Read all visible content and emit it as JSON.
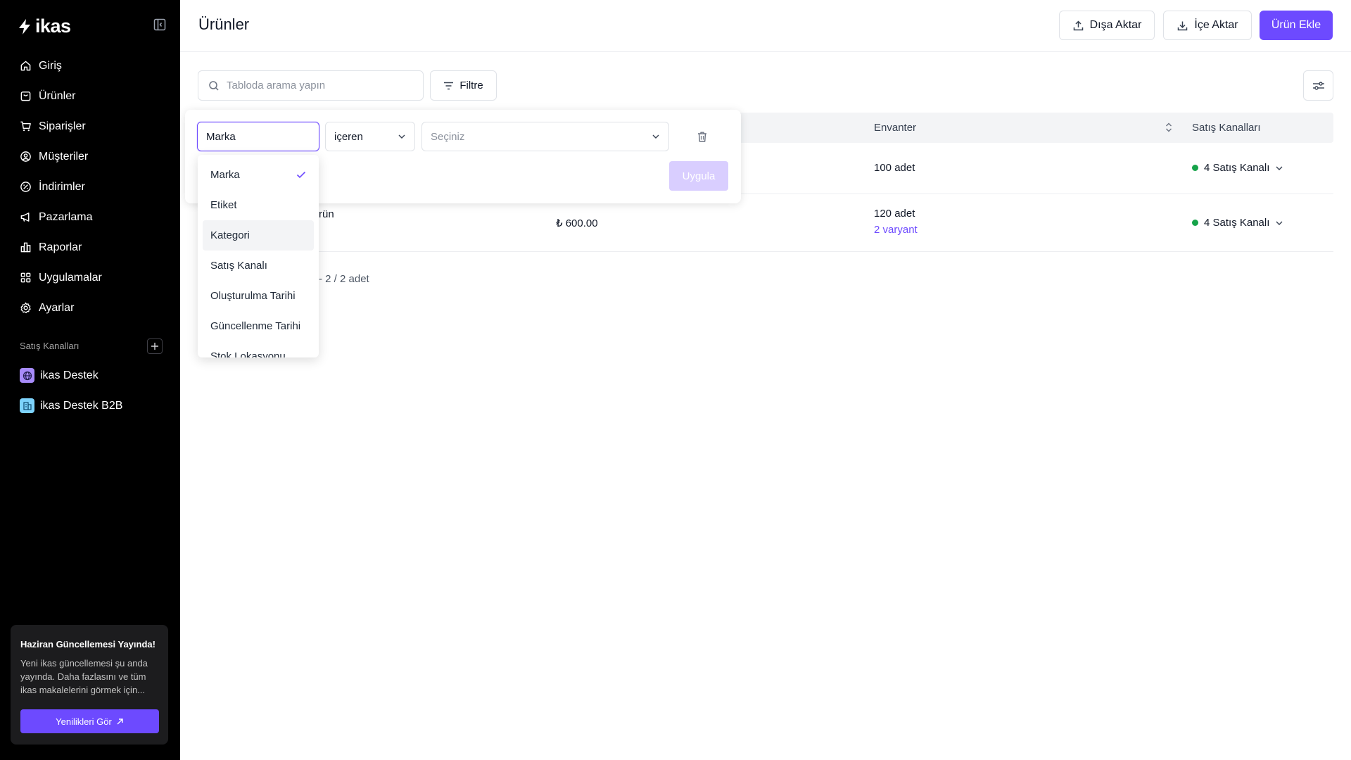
{
  "brand": {
    "name": "ikas",
    "accent": "#6d4aff"
  },
  "sidebar": {
    "items": [
      {
        "label": "Giriş",
        "icon": "home-icon"
      },
      {
        "label": "Ürünler",
        "icon": "box-icon"
      },
      {
        "label": "Siparişler",
        "icon": "cart-icon"
      },
      {
        "label": "Müşteriler",
        "icon": "user-circle-icon"
      },
      {
        "label": "İndirimler",
        "icon": "discount-icon"
      },
      {
        "label": "Pazarlama",
        "icon": "megaphone-icon"
      },
      {
        "label": "Raporlar",
        "icon": "chart-icon"
      },
      {
        "label": "Uygulamalar",
        "icon": "apps-grid-icon"
      },
      {
        "label": "Ayarlar",
        "icon": "gear-icon"
      }
    ],
    "channels_title": "Satış Kanalları",
    "channels": [
      {
        "label": "ikas Destek",
        "icon": "globe-icon",
        "color": "#a78bfa"
      },
      {
        "label": "ikas Destek B2B",
        "icon": "building-icon",
        "color": "#7dd3fc"
      }
    ],
    "promo": {
      "title": "Haziran Güncellemesi Yayında!",
      "text": "Yeni ikas güncellemesi şu anda yayında. Daha fazlasını ve tüm ikas makalelerini görmek için...",
      "button": "Yenilikleri Gör"
    }
  },
  "header": {
    "title": "Ürünler",
    "export_label": "Dışa Aktar",
    "import_label": "İçe Aktar",
    "add_label": "Ürün Ekle"
  },
  "toolbar": {
    "search_placeholder": "Tabloda arama yapın",
    "filter_label": "Filtre"
  },
  "table": {
    "columns": {
      "inventory": "Envanter",
      "channels": "Satış Kanalları"
    },
    "rows": [
      {
        "name": "",
        "price": "",
        "inventory": "100 adet",
        "variants": "",
        "channels": "4 Satış Kanalı"
      },
      {
        "name": "rün",
        "price": "₺ 600.00",
        "inventory": "120 adet",
        "variants": "2 varyant",
        "channels": "4 Satış Kanalı"
      }
    ],
    "pagination": "- 2 / 2 adet"
  },
  "filter": {
    "field_value": "Marka",
    "operator": "içeren",
    "value_placeholder": "Seçiniz",
    "apply_label": "Uygula",
    "options": [
      "Marka",
      "Etiket",
      "Kategori",
      "Satış Kanalı",
      "Oluşturulma Tarihi",
      "Güncellenme Tarihi",
      "Stok Lokasyonu"
    ],
    "selected_index": 0,
    "hover_index": 2
  }
}
